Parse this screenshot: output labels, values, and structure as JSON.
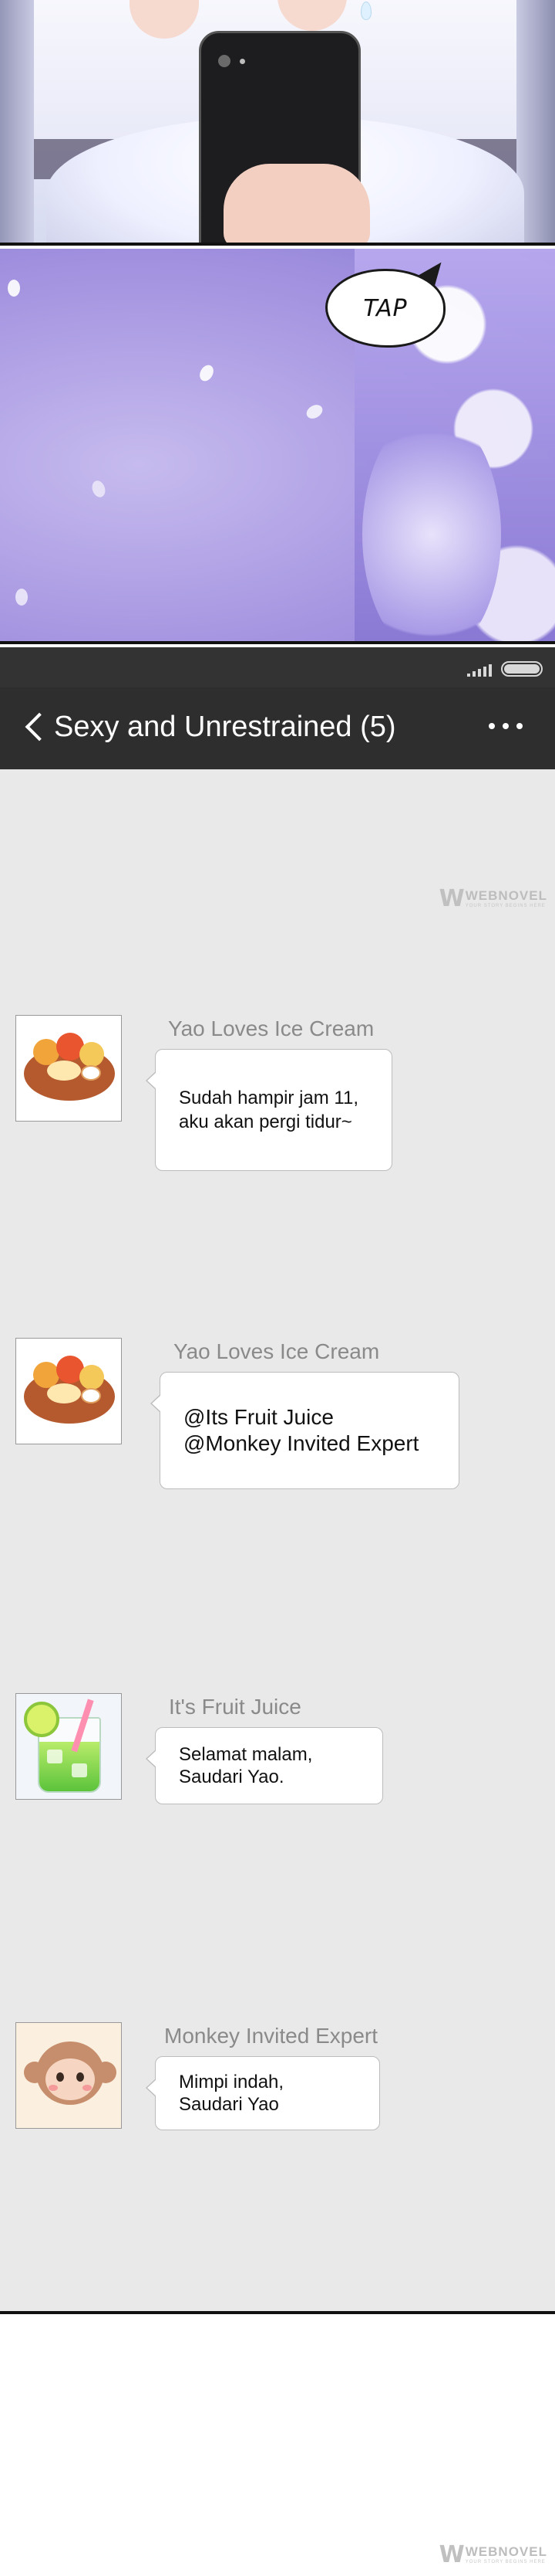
{
  "comic": {
    "tap_sfx": "TAP"
  },
  "status_bar": {
    "signal_icon": "signal-icon",
    "battery_icon": "battery-icon"
  },
  "header": {
    "back_icon": "chevron-left-icon",
    "title": "Sexy and Unrestrained (5)",
    "more_icon": "more-horizontal-icon"
  },
  "watermark": {
    "logo": "W",
    "brand": "WEBNOVEL",
    "tagline": "YOUR STORY BEGINS HERE"
  },
  "messages": [
    {
      "sender": "Yao Loves Ice Cream",
      "avatar": "food-platter-avatar",
      "lines": [
        "Sudah hampir jam 11,",
        "aku akan pergi tidur~"
      ]
    },
    {
      "sender": "Yao Loves Ice Cream",
      "avatar": "food-platter-avatar",
      "lines": [
        "@Its Fruit Juice",
        "@Monkey Invited Expert"
      ]
    },
    {
      "sender": "It's Fruit Juice",
      "avatar": "fruit-juice-avatar",
      "lines": [
        "Selamat malam,",
        "Saudari Yao."
      ]
    },
    {
      "sender": "Monkey Invited Expert",
      "avatar": "monkey-avatar",
      "lines": [
        "Mimpi indah,",
        "Saudari Yao"
      ]
    }
  ],
  "colors": {
    "header_bg": "#2e2e2e",
    "status_bg": "#333333",
    "chat_bg": "#e9e9e9",
    "bubble_bg": "#ffffff",
    "sender_text": "#8a8a8a"
  }
}
